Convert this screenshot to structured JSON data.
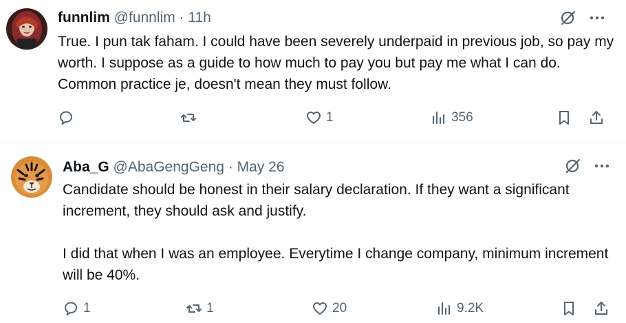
{
  "tweets": [
    {
      "name": "funnlim",
      "handle": "@funnlim",
      "separator": "·",
      "time": "11h",
      "text": "True. I pun tak faham. I could have been severely underpaid in previous job, so pay my worth. I suppose as a guide to how much to pay you but pay me what I can do. Common practice je, doesn't mean they must follow.",
      "replies": "",
      "reposts": "",
      "likes": "1",
      "views": "356"
    },
    {
      "name": "Aba_G",
      "handle": "@AbaGengGeng",
      "separator": "·",
      "time": "May 26",
      "text": "Candidate should be honest in their salary declaration. If they want a significant increment, they should ask and justify.\n\nI did that when I was an employee. Everytime I change company, minimum increment will be 40%.",
      "replies": "1",
      "reposts": "1",
      "likes": "20",
      "views": "9.2K"
    }
  ],
  "icons": {
    "reply": "reply-icon",
    "repost": "repost-icon",
    "like": "like-icon",
    "views": "views-icon",
    "bookmark": "bookmark-icon",
    "share": "share-icon",
    "grok": "grok-icon",
    "more": "more-icon"
  },
  "colors": {
    "text": "#0f1419",
    "secondary": "#536471",
    "divider": "#eff3f4"
  }
}
